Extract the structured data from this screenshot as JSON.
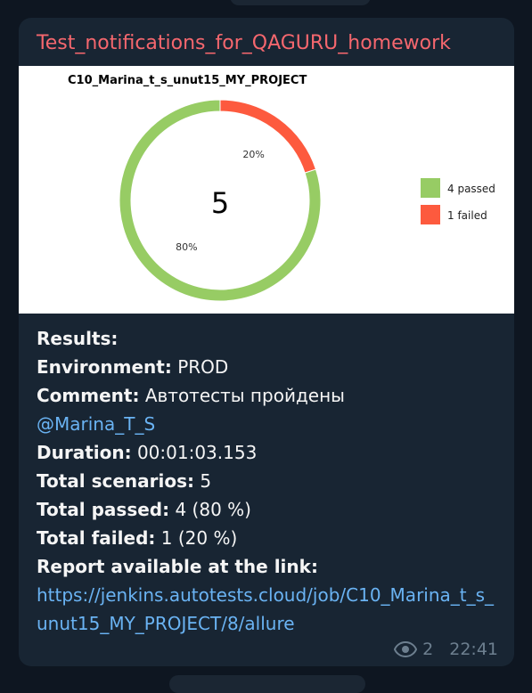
{
  "message": {
    "channel_title": "Test_notifications_for_QAGURU_homework",
    "views": "2",
    "time": "22:41"
  },
  "chart_data": {
    "type": "pie",
    "title": "C10_Marina_t_s_unut15_MY_PROJECT",
    "center_label": "5",
    "slices": [
      {
        "label": "4 passed",
        "value": 4,
        "percent_label": "80%",
        "color": "#97cc64"
      },
      {
        "label": "1 failed",
        "value": 1,
        "percent_label": "20%",
        "color": "#fd5a3e"
      }
    ],
    "legend_position": "right"
  },
  "report": {
    "results_label": "Results:",
    "environment_label": "Environment:",
    "environment_value": "PROD",
    "comment_label": "Comment:",
    "comment_value": "Автотесты пройдены",
    "mention": "@Marina_T_S",
    "duration_label": "Duration:",
    "duration_value": "00:01:03.153",
    "total_scenarios_label": "Total scenarios:",
    "total_scenarios_value": "5",
    "total_passed_label": "Total passed:",
    "total_passed_value": "4 (80 %)",
    "total_failed_label": "Total failed:",
    "total_failed_value": "1 (20 %)",
    "link_label": "Report available at the link:",
    "link_url": "https://jenkins.autotests.cloud/job/C10_Marina_t_s_unut15_MY_PROJECT/8/allure"
  }
}
